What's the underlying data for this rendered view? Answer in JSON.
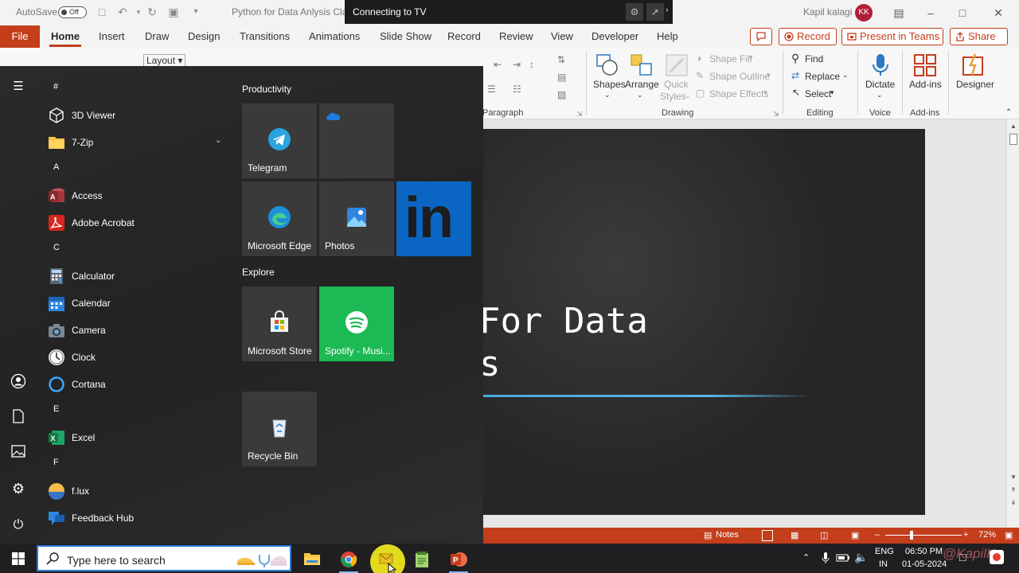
{
  "titlebar": {
    "autosave_label": "AutoSave",
    "autosave_state": "Off",
    "document_title": "Python for Data Anlysis Class",
    "user_name": "Kapil kalagi",
    "user_initials": "KK"
  },
  "cast": {
    "title": "Connecting to TV"
  },
  "ribbon_tabs": {
    "file": "File",
    "tabs": [
      "Home",
      "Insert",
      "Draw",
      "Design",
      "Transitions",
      "Animations",
      "Slide Show",
      "Record",
      "Review",
      "View",
      "Developer",
      "Help"
    ],
    "record_button": "Record",
    "present_teams_button": "Present in Teams",
    "share_button": "Share"
  },
  "ribbon": {
    "layout_label": "Layout",
    "paragraph_label": "Paragraph",
    "drawing": {
      "shapes": "Shapes",
      "arrange": "Arrange",
      "quick_styles_line1": "Quick",
      "quick_styles_line2": "Styles",
      "shape_fill": "Shape Fill",
      "shape_outline": "Shape Outline",
      "shape_effects": "Shape Effects",
      "group_label": "Drawing"
    },
    "editing": {
      "find": "Find",
      "replace": "Replace",
      "select": "Select",
      "group_label": "Editing"
    },
    "voice": {
      "dictate": "Dictate",
      "group_label": "Voice"
    },
    "addins": {
      "addins": "Add-ins",
      "group_label": "Add-ins"
    },
    "designer": "Designer"
  },
  "slide": {
    "title_line1": "For Data",
    "title_line2": "s"
  },
  "statusbar": {
    "notes": "Notes",
    "zoom": "72%",
    "zoom_level_percent": 72
  },
  "start_menu": {
    "apps": [
      {
        "type": "letter",
        "text": "#"
      },
      {
        "type": "app",
        "label": "3D Viewer",
        "icon": "cube-icon"
      },
      {
        "type": "app",
        "label": "7-Zip",
        "icon": "folder-icon",
        "expandable": true
      },
      {
        "type": "letter",
        "text": "A"
      },
      {
        "type": "app",
        "label": "Access",
        "icon": "access-icon"
      },
      {
        "type": "app",
        "label": "Adobe Acrobat",
        "icon": "acrobat-icon"
      },
      {
        "type": "letter",
        "text": "C"
      },
      {
        "type": "app",
        "label": "Calculator",
        "icon": "calculator-icon"
      },
      {
        "type": "app",
        "label": "Calendar",
        "icon": "calendar-icon"
      },
      {
        "type": "app",
        "label": "Camera",
        "icon": "camera-icon"
      },
      {
        "type": "app",
        "label": "Clock",
        "icon": "clock-icon"
      },
      {
        "type": "app",
        "label": "Cortana",
        "icon": "cortana-icon"
      },
      {
        "type": "letter",
        "text": "E"
      },
      {
        "type": "app",
        "label": "Excel",
        "icon": "excel-icon"
      },
      {
        "type": "letter",
        "text": "F"
      },
      {
        "type": "app",
        "label": "f.lux",
        "icon": "flux-icon"
      },
      {
        "type": "app",
        "label": "Feedback Hub",
        "icon": "feedback-icon"
      }
    ],
    "groups": {
      "productivity": "Productivity",
      "explore": "Explore"
    },
    "tiles": {
      "telegram": "Telegram",
      "onedrive": "",
      "edge": "Microsoft Edge",
      "photos": "Photos",
      "linkedin": "in",
      "store": "Microsoft Store",
      "spotify": "Spotify - Musi...",
      "recycle": "Recycle Bin"
    }
  },
  "taskbar": {
    "search_placeholder": "Type here to search",
    "language_line1": "ENG",
    "language_line2": "IN",
    "time": "06:50 PM",
    "date": "01-05-2024",
    "watermark": "@KapilK"
  },
  "colors": {
    "accent": "#c43e1c",
    "spotify": "#1db954",
    "linkedin": "#0a66c2",
    "taskbar": "#1f1f22"
  }
}
